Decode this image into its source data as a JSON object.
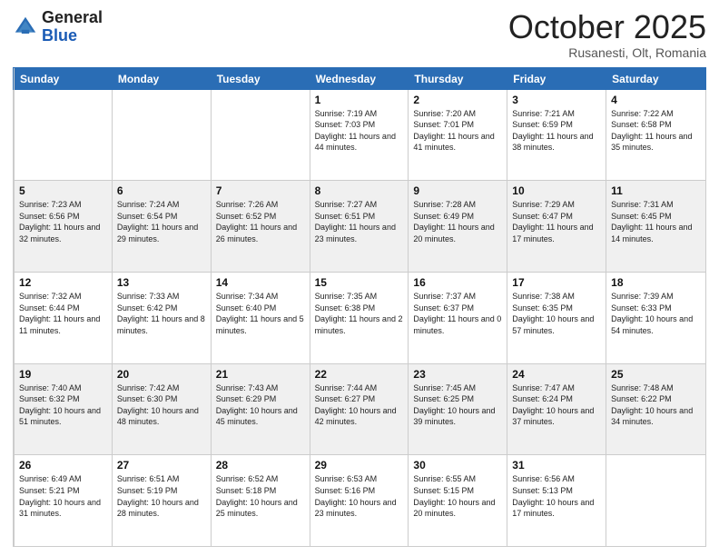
{
  "header": {
    "logo": {
      "line1": "General",
      "line2": "Blue"
    },
    "month": "October 2025",
    "location": "Rusanesti, Olt, Romania"
  },
  "days_of_week": [
    "Sunday",
    "Monday",
    "Tuesday",
    "Wednesday",
    "Thursday",
    "Friday",
    "Saturday"
  ],
  "rows": [
    [
      {
        "num": "",
        "info": ""
      },
      {
        "num": "",
        "info": ""
      },
      {
        "num": "",
        "info": ""
      },
      {
        "num": "1",
        "info": "Sunrise: 7:19 AM\nSunset: 7:03 PM\nDaylight: 11 hours\nand 44 minutes."
      },
      {
        "num": "2",
        "info": "Sunrise: 7:20 AM\nSunset: 7:01 PM\nDaylight: 11 hours\nand 41 minutes."
      },
      {
        "num": "3",
        "info": "Sunrise: 7:21 AM\nSunset: 6:59 PM\nDaylight: 11 hours\nand 38 minutes."
      },
      {
        "num": "4",
        "info": "Sunrise: 7:22 AM\nSunset: 6:58 PM\nDaylight: 11 hours\nand 35 minutes."
      }
    ],
    [
      {
        "num": "5",
        "info": "Sunrise: 7:23 AM\nSunset: 6:56 PM\nDaylight: 11 hours\nand 32 minutes."
      },
      {
        "num": "6",
        "info": "Sunrise: 7:24 AM\nSunset: 6:54 PM\nDaylight: 11 hours\nand 29 minutes."
      },
      {
        "num": "7",
        "info": "Sunrise: 7:26 AM\nSunset: 6:52 PM\nDaylight: 11 hours\nand 26 minutes."
      },
      {
        "num": "8",
        "info": "Sunrise: 7:27 AM\nSunset: 6:51 PM\nDaylight: 11 hours\nand 23 minutes."
      },
      {
        "num": "9",
        "info": "Sunrise: 7:28 AM\nSunset: 6:49 PM\nDaylight: 11 hours\nand 20 minutes."
      },
      {
        "num": "10",
        "info": "Sunrise: 7:29 AM\nSunset: 6:47 PM\nDaylight: 11 hours\nand 17 minutes."
      },
      {
        "num": "11",
        "info": "Sunrise: 7:31 AM\nSunset: 6:45 PM\nDaylight: 11 hours\nand 14 minutes."
      }
    ],
    [
      {
        "num": "12",
        "info": "Sunrise: 7:32 AM\nSunset: 6:44 PM\nDaylight: 11 hours\nand 11 minutes."
      },
      {
        "num": "13",
        "info": "Sunrise: 7:33 AM\nSunset: 6:42 PM\nDaylight: 11 hours\nand 8 minutes."
      },
      {
        "num": "14",
        "info": "Sunrise: 7:34 AM\nSunset: 6:40 PM\nDaylight: 11 hours\nand 5 minutes."
      },
      {
        "num": "15",
        "info": "Sunrise: 7:35 AM\nSunset: 6:38 PM\nDaylight: 11 hours\nand 2 minutes."
      },
      {
        "num": "16",
        "info": "Sunrise: 7:37 AM\nSunset: 6:37 PM\nDaylight: 11 hours\nand 0 minutes."
      },
      {
        "num": "17",
        "info": "Sunrise: 7:38 AM\nSunset: 6:35 PM\nDaylight: 10 hours\nand 57 minutes."
      },
      {
        "num": "18",
        "info": "Sunrise: 7:39 AM\nSunset: 6:33 PM\nDaylight: 10 hours\nand 54 minutes."
      }
    ],
    [
      {
        "num": "19",
        "info": "Sunrise: 7:40 AM\nSunset: 6:32 PM\nDaylight: 10 hours\nand 51 minutes."
      },
      {
        "num": "20",
        "info": "Sunrise: 7:42 AM\nSunset: 6:30 PM\nDaylight: 10 hours\nand 48 minutes."
      },
      {
        "num": "21",
        "info": "Sunrise: 7:43 AM\nSunset: 6:29 PM\nDaylight: 10 hours\nand 45 minutes."
      },
      {
        "num": "22",
        "info": "Sunrise: 7:44 AM\nSunset: 6:27 PM\nDaylight: 10 hours\nand 42 minutes."
      },
      {
        "num": "23",
        "info": "Sunrise: 7:45 AM\nSunset: 6:25 PM\nDaylight: 10 hours\nand 39 minutes."
      },
      {
        "num": "24",
        "info": "Sunrise: 7:47 AM\nSunset: 6:24 PM\nDaylight: 10 hours\nand 37 minutes."
      },
      {
        "num": "25",
        "info": "Sunrise: 7:48 AM\nSunset: 6:22 PM\nDaylight: 10 hours\nand 34 minutes."
      }
    ],
    [
      {
        "num": "26",
        "info": "Sunrise: 6:49 AM\nSunset: 5:21 PM\nDaylight: 10 hours\nand 31 minutes."
      },
      {
        "num": "27",
        "info": "Sunrise: 6:51 AM\nSunset: 5:19 PM\nDaylight: 10 hours\nand 28 minutes."
      },
      {
        "num": "28",
        "info": "Sunrise: 6:52 AM\nSunset: 5:18 PM\nDaylight: 10 hours\nand 25 minutes."
      },
      {
        "num": "29",
        "info": "Sunrise: 6:53 AM\nSunset: 5:16 PM\nDaylight: 10 hours\nand 23 minutes."
      },
      {
        "num": "30",
        "info": "Sunrise: 6:55 AM\nSunset: 5:15 PM\nDaylight: 10 hours\nand 20 minutes."
      },
      {
        "num": "31",
        "info": "Sunrise: 6:56 AM\nSunset: 5:13 PM\nDaylight: 10 hours\nand 17 minutes."
      },
      {
        "num": "",
        "info": ""
      }
    ]
  ]
}
